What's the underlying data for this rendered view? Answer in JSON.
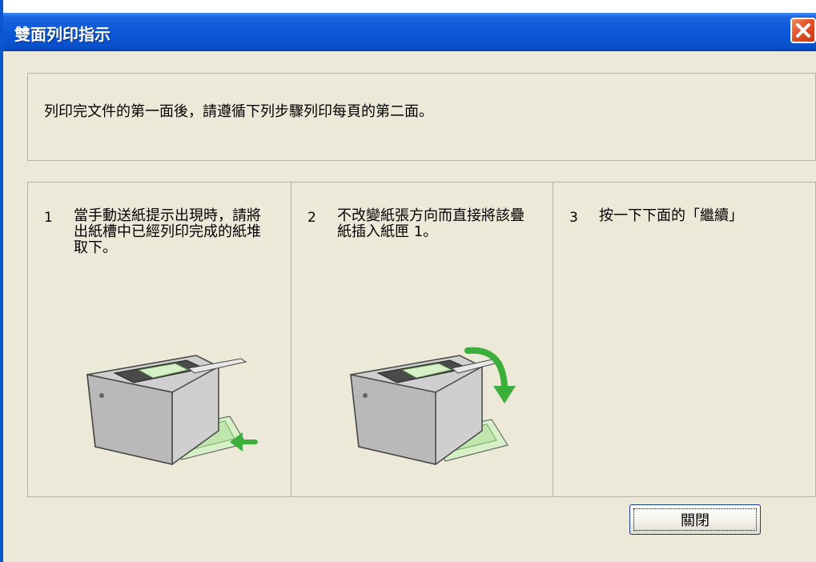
{
  "window": {
    "title": "雙面列印指示"
  },
  "instruction": "列印完文件的第一面後，請遵循下列步驟列印每頁的第二面。",
  "steps": [
    {
      "num": "1",
      "text": "當手動送紙提示出現時，請將出紙槽中已經列印完成的紙堆取下。"
    },
    {
      "num": "2",
      "text": "不改變紙張方向而直接將該疊紙插入紙匣 1。"
    },
    {
      "num": "3",
      "text": "按一下下面的「繼續」"
    }
  ],
  "buttons": {
    "close_label": "關閉"
  },
  "icons": {
    "title_close": "close-icon",
    "arrow_step1": "arrow-left-icon",
    "arrow_step2": "arrow-curved-down-icon"
  },
  "colors": {
    "titlebar": "#0a4fca",
    "close_button": "#e2532a",
    "background": "#ece9d8",
    "arrow": "#3cae3a"
  }
}
